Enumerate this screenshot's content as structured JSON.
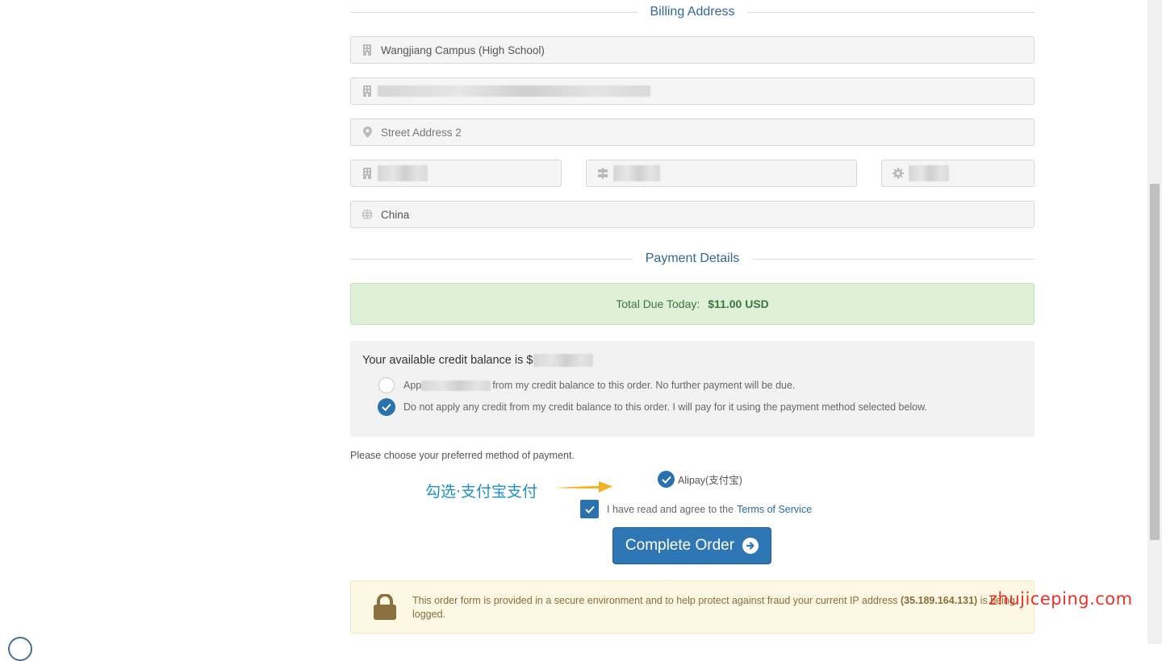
{
  "billing": {
    "section_title": "Billing Address",
    "company_value": "Wangjiang Campus (High School)",
    "street2_placeholder": "Street Address 2",
    "country_value": "China"
  },
  "payment": {
    "section_title": "Payment Details",
    "total_label": "Total Due Today:",
    "total_amount": "$11.00 USD",
    "credit_title": "Your available credit balance is $",
    "apply_option_prefix": "App",
    "apply_option_suffix": "from my credit balance to this order. No further payment will be due.",
    "no_apply_option": "Do not apply any credit from my credit balance to this order. I will pay for it using the payment method selected below.",
    "choose_method": "Please choose your preferred method of payment.",
    "alipay_label": "Alipay(支付宝)",
    "tos_text": "I have read and agree to the",
    "tos_link": "Terms of Service",
    "complete_button": "Complete Order"
  },
  "annotation": {
    "text": "勾选·支付宝支付"
  },
  "secure_notice": {
    "text_before_ip": "This order form is provided in a secure environment and to help protect against fraud your current IP address",
    "ip": "(35.189.164.131)",
    "text_after_ip": "is being logged."
  },
  "watermark": "zhujiceping.com",
  "colors": {
    "accent": "#2a72ad",
    "success_bg": "#dff0d8",
    "warning_bg": "#fcf8e3",
    "annotation": "#1e90c8",
    "watermark": "#e8332a"
  },
  "icons": [
    "building-icon",
    "map-marker-icon",
    "signpost-icon",
    "gear-icon",
    "globe-icon",
    "lock-icon",
    "arrow-circle-right-icon",
    "check-icon"
  ]
}
